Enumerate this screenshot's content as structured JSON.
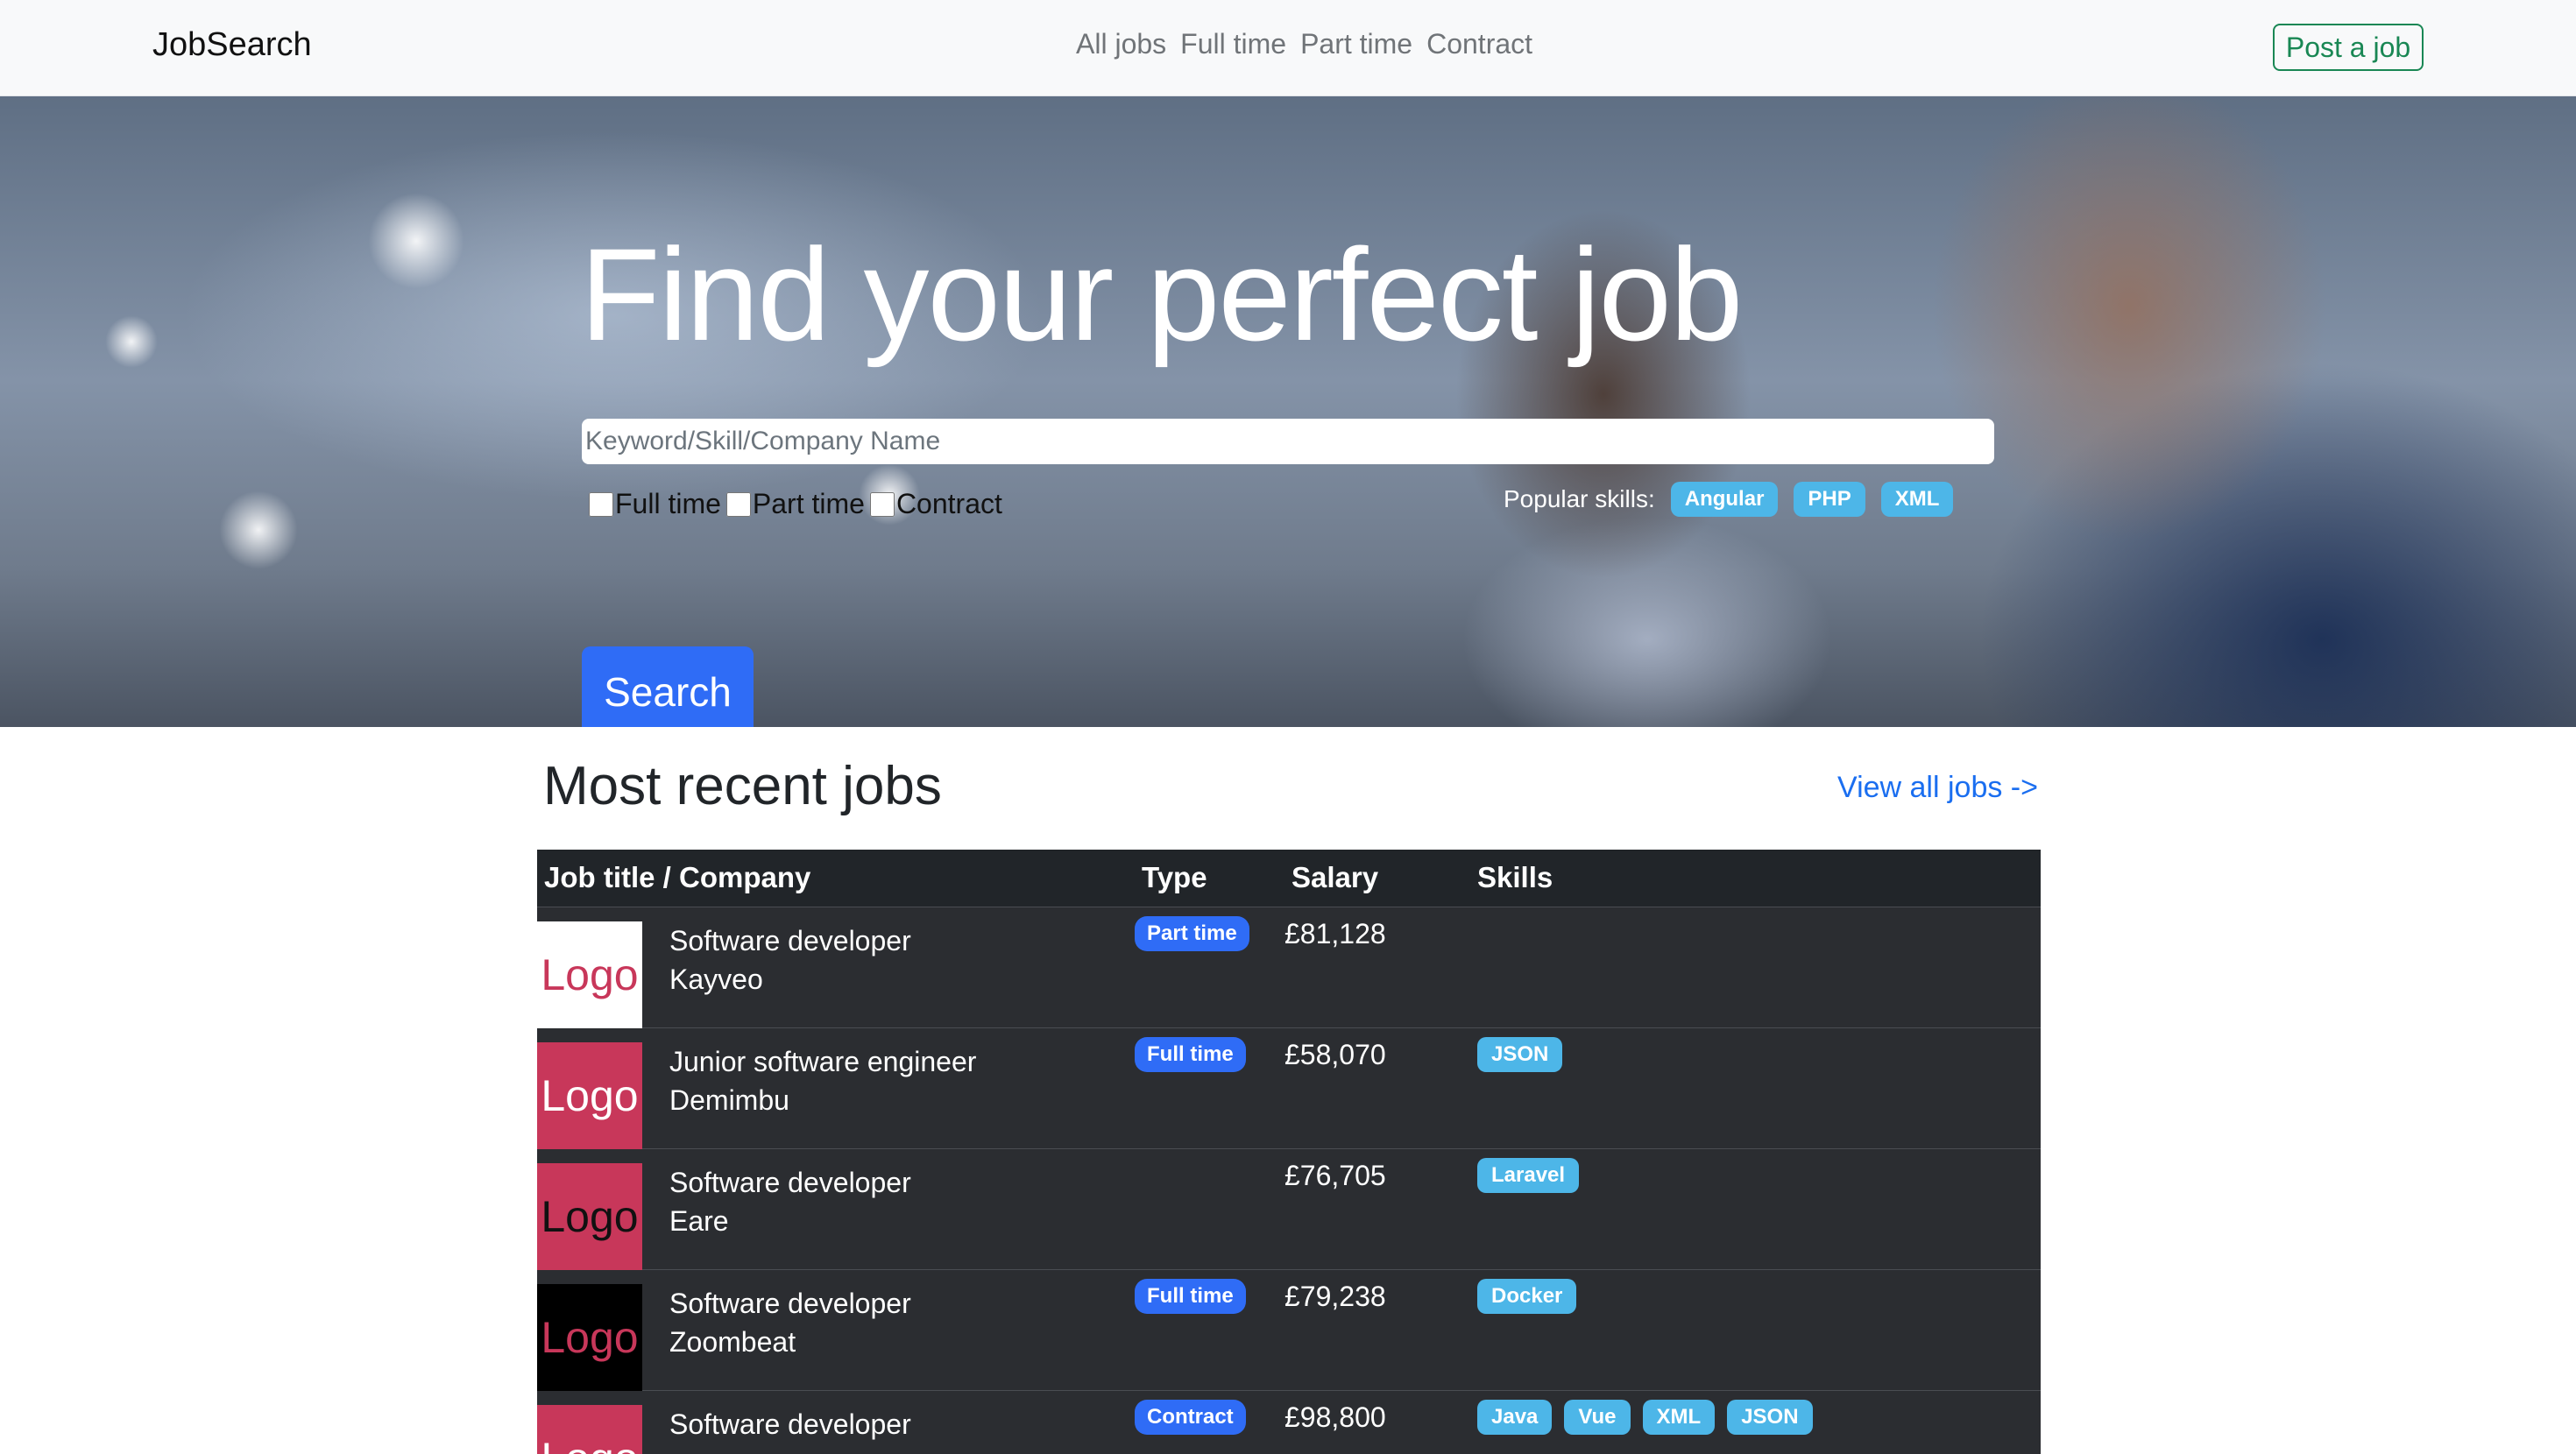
{
  "navbar": {
    "brand": "JobSearch",
    "links": [
      "All jobs",
      "Full time",
      "Part time",
      "Contract"
    ],
    "post_job": "Post a job"
  },
  "hero": {
    "title": "Find your perfect job",
    "search_placeholder": "Keyword/Skill/Company Name",
    "filters": [
      "Full time",
      "Part time",
      "Contract"
    ],
    "popular_label": "Popular skills:",
    "popular_skills": [
      "Angular",
      "PHP",
      "XML"
    ],
    "search_button": "Search"
  },
  "section": {
    "title": "Most recent jobs",
    "view_all": "View all jobs ->"
  },
  "table": {
    "headers": [
      "Job title / Company",
      "Type",
      "Salary",
      "Skills"
    ],
    "rows": [
      {
        "logo": "Logo",
        "logo_bg": "#ffffff",
        "logo_fg": "#c8375a",
        "title": "Software developer",
        "company": "Kayveo",
        "type": "Part time",
        "salary": "£81,128",
        "skills": []
      },
      {
        "logo": "Logo",
        "logo_bg": "#c8375a",
        "logo_fg": "#ffffff",
        "title": "Junior software engineer",
        "company": "Demimbu",
        "type": "Full time",
        "salary": "£58,070",
        "skills": [
          "JSON"
        ]
      },
      {
        "logo": "Logo",
        "logo_bg": "#c8375a",
        "logo_fg": "#111111",
        "title": "Software developer",
        "company": "Eare",
        "type": "",
        "salary": "£76,705",
        "skills": [
          "Laravel"
        ]
      },
      {
        "logo": "Logo",
        "logo_bg": "#000000",
        "logo_fg": "#c8375a",
        "title": "Software developer",
        "company": "Zoombeat",
        "type": "Full time",
        "salary": "£79,238",
        "skills": [
          "Docker"
        ]
      },
      {
        "logo": "Logo",
        "logo_bg": "#c8375a",
        "logo_fg": "#ffffff",
        "title": "Software developer",
        "company": "",
        "type": "Contract",
        "salary": "£98,800",
        "skills": [
          "Java",
          "Vue",
          "XML",
          "JSON"
        ]
      }
    ]
  },
  "colors": {
    "primary": "#2f6cf6",
    "info": "#4db6e8",
    "success": "#198754",
    "table_bg": "#2b2d31"
  }
}
